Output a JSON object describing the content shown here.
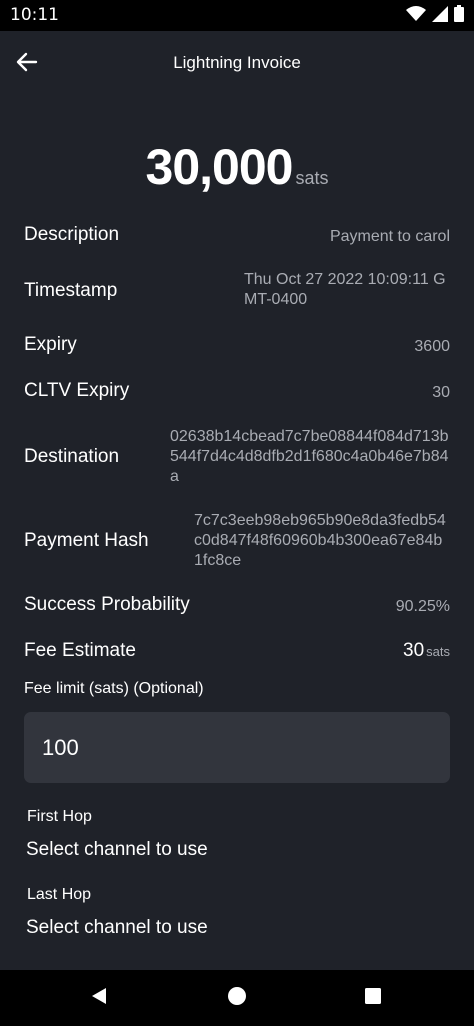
{
  "status_bar": {
    "time": "10:11",
    "icons": [
      "wifi-icon",
      "signal-icon",
      "battery-icon"
    ]
  },
  "header": {
    "title": "Lightning Invoice",
    "back_icon": "arrow-left-icon"
  },
  "amount": {
    "value": "30,000",
    "unit": "sats"
  },
  "details": [
    {
      "label": "Description",
      "value": "Payment to carol"
    },
    {
      "label": "Timestamp",
      "value": "Thu Oct 27 2022 10:09:11 GMT-0400"
    },
    {
      "label": "Expiry",
      "value": "3600"
    },
    {
      "label": "CLTV Expiry",
      "value": "30"
    },
    {
      "label": "Destination",
      "value": "02638b14cbead7c7be08844f084d713b544f7d4c4d8dfb2d1f680c4a0b46e7b84a"
    },
    {
      "label": "Payment Hash",
      "value": "7c7c3eeb98eb965b90e8da3fedb54c0d847f48f60960b4b300ea67e84b1fc8ce"
    },
    {
      "label": "Success Probability",
      "value": "90.25%"
    }
  ],
  "fee_estimate": {
    "label": "Fee Estimate",
    "value": "30",
    "unit": "sats"
  },
  "fee_limit": {
    "label": "Fee limit (sats) (Optional)",
    "value": "100"
  },
  "first_hop": {
    "label": "First Hop",
    "value": "Select channel to use"
  },
  "last_hop": {
    "label": "Last Hop",
    "value": "Select channel to use"
  },
  "colors": {
    "background": "#1f2229",
    "input_background": "#32353d",
    "secondary_text": "#a9acb3",
    "primary_text": "#ffffff"
  },
  "nav_bar": {
    "icons": [
      "back-triangle-icon",
      "home-circle-icon",
      "recents-square-icon"
    ]
  }
}
